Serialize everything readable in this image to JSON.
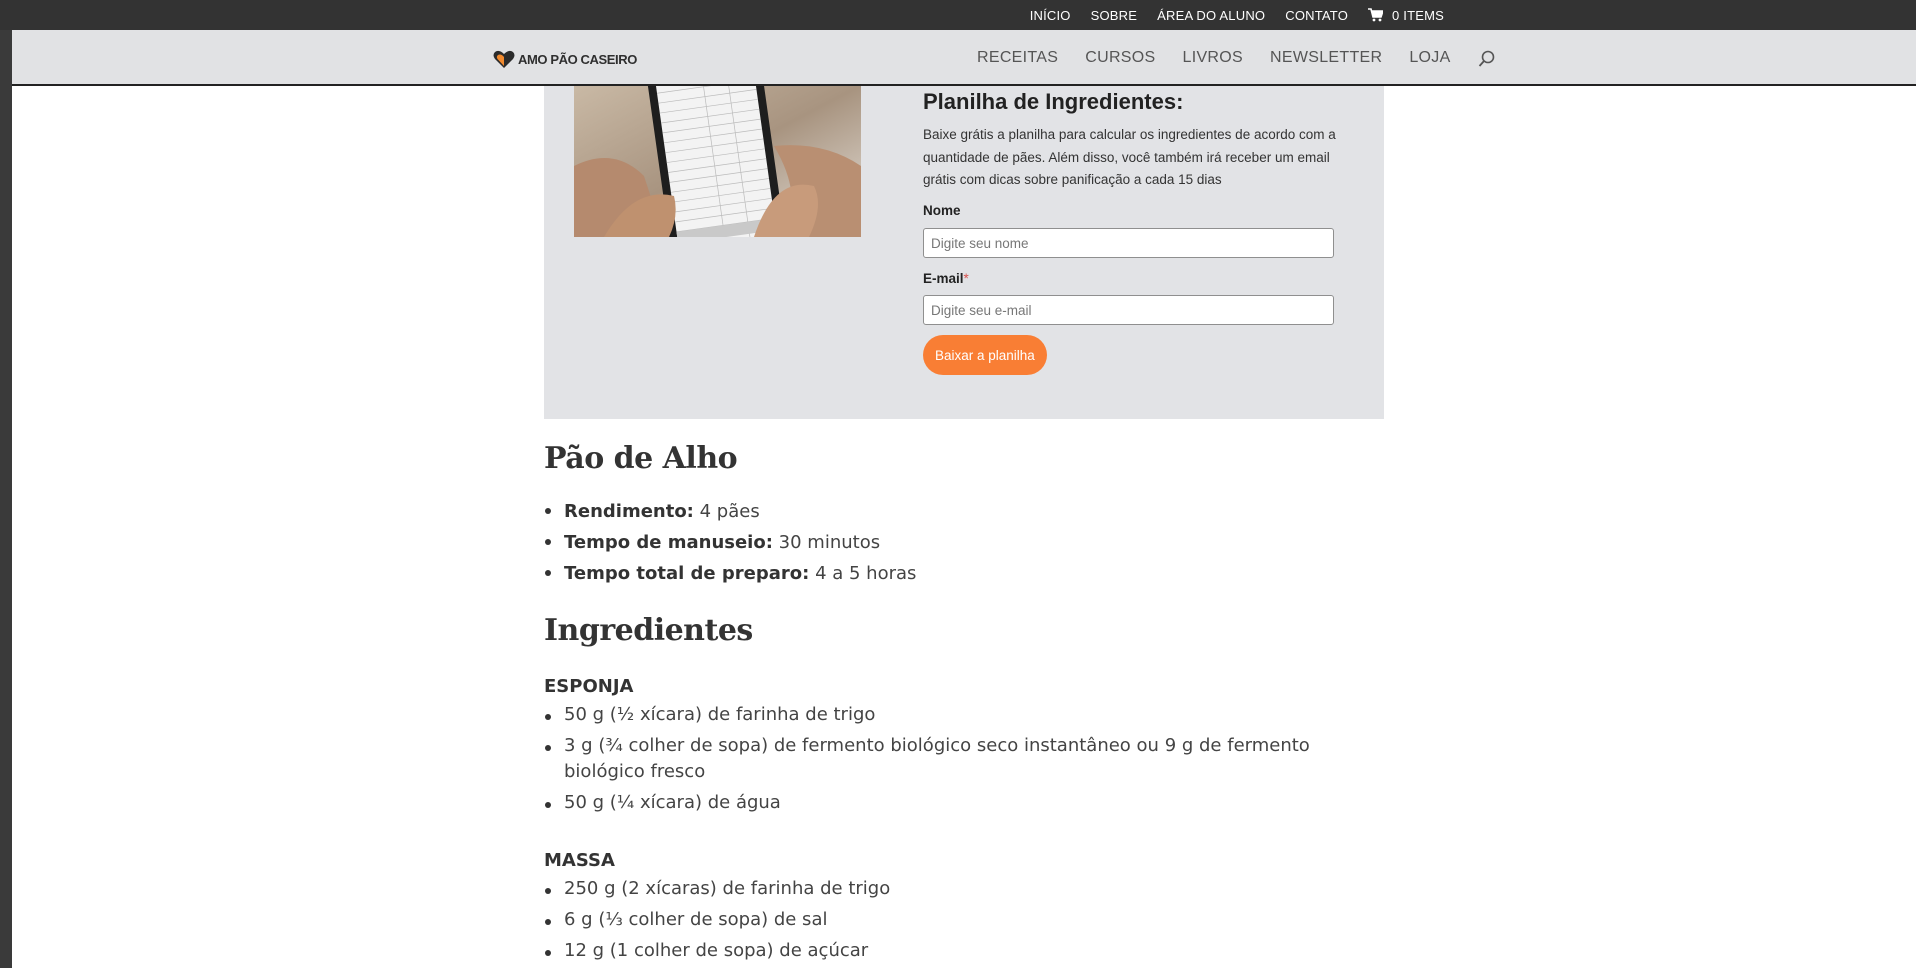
{
  "topbar": {
    "links": [
      "INÍCIO",
      "SOBRE",
      "ÁREA DO ALUNO",
      "CONTATO"
    ],
    "cart_label": "0 ITEMS"
  },
  "header": {
    "logo_text": "AMO PÃO CASEIRO",
    "nav": [
      "RECEITAS",
      "CURSOS",
      "LIVROS",
      "NEWSLETTER",
      "LOJA"
    ]
  },
  "optin": {
    "title": "Planilha de Ingredientes:",
    "description": "Baixe grátis a planilha para calcular os ingredientes de acordo com a quantidade de pães. Além disso, você também irá receber um email grátis com dicas sobre panificação a cada 15 dias",
    "name_label": "Nome",
    "name_placeholder": "Digite seu nome",
    "email_label": "E-mail",
    "email_required_mark": "*",
    "email_placeholder": "Digite seu e-mail",
    "button_label": "Baixar a planilha"
  },
  "recipe": {
    "title": "Pão de Alho",
    "meta": [
      {
        "label": "Rendimento:",
        "value": "4 pães"
      },
      {
        "label": "Tempo de manuseio:",
        "value": "30 minutos"
      },
      {
        "label": "Tempo total de preparo:",
        "value": "4 a 5 horas"
      }
    ],
    "ingredients_title": "Ingredientes",
    "sections": [
      {
        "name": "ESPONJA",
        "items": [
          "50 g (½ xícara) de farinha de trigo",
          "3 g (¾ colher de sopa) de fermento biológico seco instantâneo ou 9 g de fermento biológico fresco",
          "50 g (¼ xícara) de água"
        ]
      },
      {
        "name": "MASSA",
        "items": [
          "250 g (2 xícaras) de farinha de trigo",
          "6 g (⅓ colher de sopa) de sal",
          "12 g (1 colher de sopa) de açúcar"
        ]
      }
    ]
  },
  "colors": {
    "topbar": "#333333",
    "header": "#e1e2e4",
    "optin_bg": "#e2e3e6",
    "cta": "#f97e34"
  }
}
